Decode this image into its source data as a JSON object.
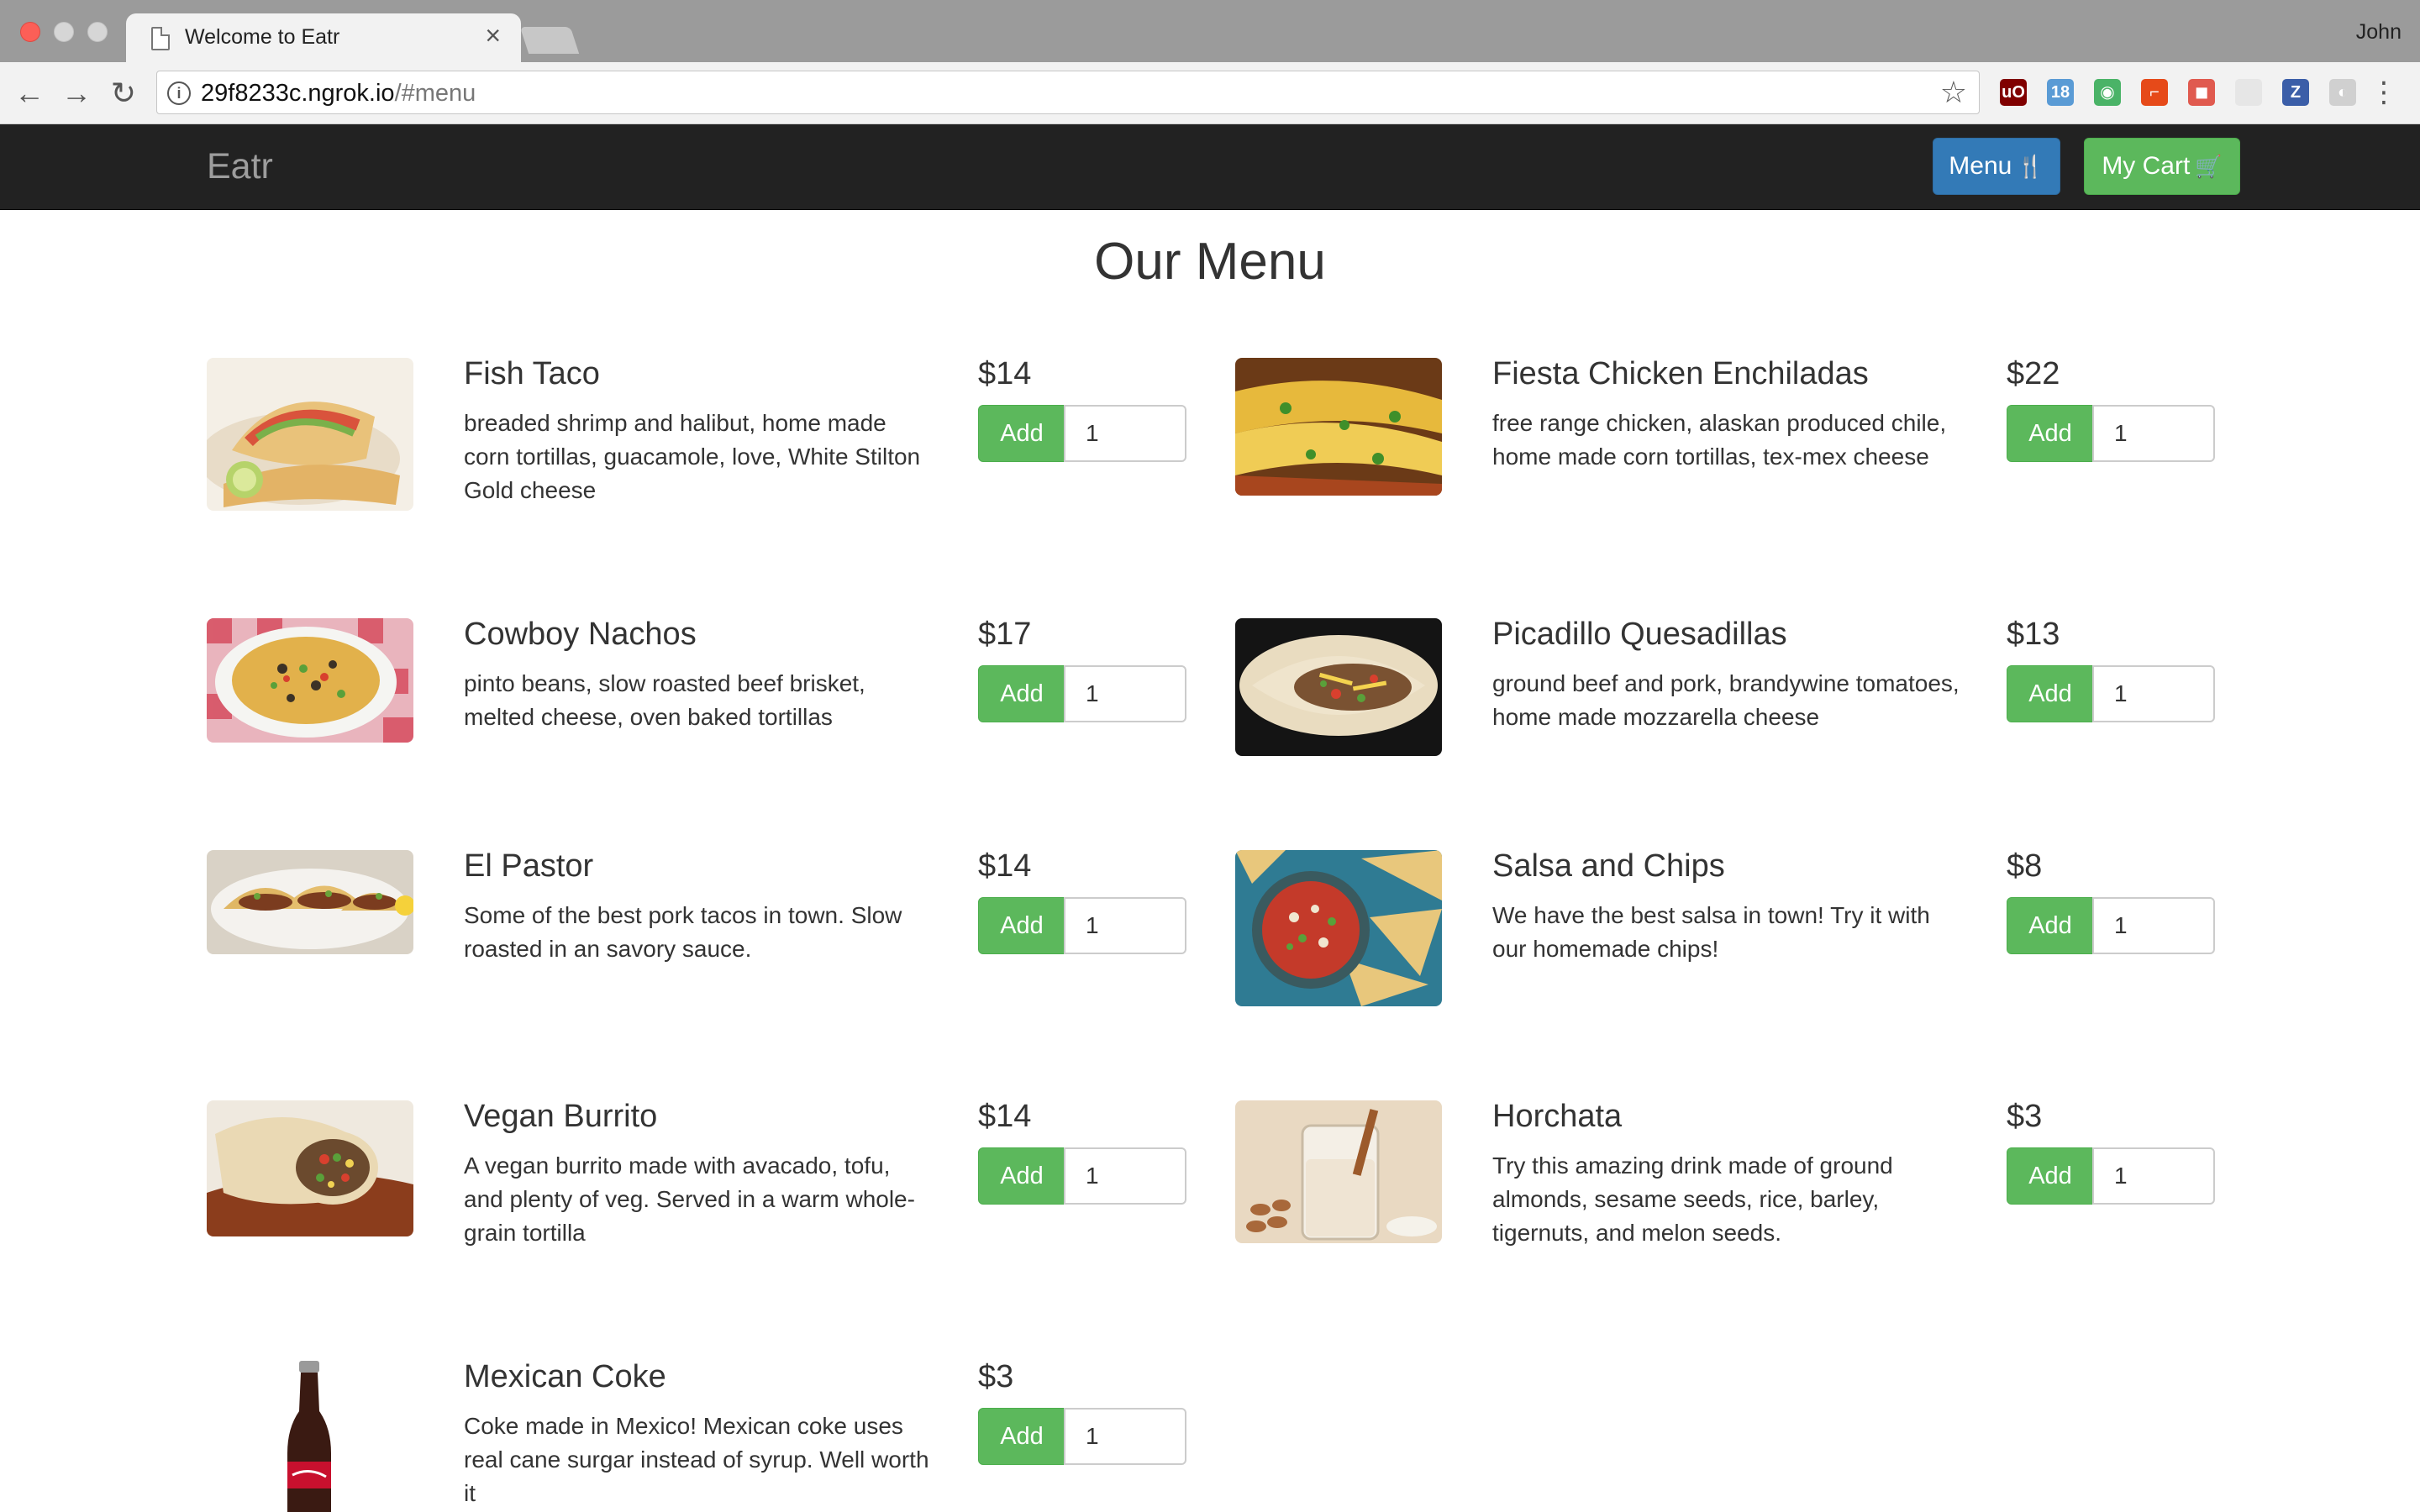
{
  "browser": {
    "tab_title": "Welcome to Eatr",
    "tab_close": "×",
    "profile_name": "John",
    "url_host": "29f8233c.ngrok.io",
    "url_path": "/#menu",
    "back_icon": "←",
    "forward_icon": "→",
    "reload_icon": "↻",
    "info_icon": "i",
    "star_icon": "☆",
    "menu_icon": "⋮",
    "extensions": [
      {
        "name": "ublock-icon",
        "glyph": "uO",
        "color": "#800000"
      },
      {
        "name": "calendar-icon",
        "glyph": "18",
        "color": "#5a9bd5"
      },
      {
        "name": "pushbullet-icon",
        "glyph": "◉",
        "color": "#4ab367"
      },
      {
        "name": "office-icon",
        "glyph": "⌐",
        "color": "#e64a19"
      },
      {
        "name": "screenshot-icon",
        "glyph": "◼",
        "color": "#e05a4f"
      },
      {
        "name": "blank-extension-icon",
        "glyph": "",
        "color": "#e6e6e6"
      },
      {
        "name": "zotero-icon",
        "glyph": "Z",
        "color": "#3b5ea8"
      },
      {
        "name": "feather-icon",
        "glyph": "◐",
        "color": "#d0d0d0"
      }
    ]
  },
  "navbar": {
    "brand": "Eatr",
    "menu_label": "Menu",
    "menu_icon": "🍴",
    "cart_label": "My Cart",
    "cart_icon": "🛒"
  },
  "page": {
    "title": "Our Menu",
    "items": [
      {
        "name": "Fish Taco",
        "description": "breaded shrimp and halibut, home made corn tortillas, guacamole, love, White Stilton Gold cheese",
        "price": "$14",
        "add_label": "Add",
        "qty": "1"
      },
      {
        "name": "Fiesta Chicken Enchiladas",
        "description": "free range chicken, alaskan produced chile, home made corn tortillas, tex-mex cheese",
        "price": "$22",
        "add_label": "Add",
        "qty": "1"
      },
      {
        "name": "Cowboy Nachos",
        "description": "pinto beans, slow roasted beef brisket, melted cheese, oven baked tortillas",
        "price": "$17",
        "add_label": "Add",
        "qty": "1"
      },
      {
        "name": "Picadillo Quesadillas",
        "description": "ground beef and pork, brandywine tomatoes, home made mozzarella cheese",
        "price": "$13",
        "add_label": "Add",
        "qty": "1"
      },
      {
        "name": "El Pastor",
        "description": "Some of the best pork tacos in town. Slow roasted in an savory sauce.",
        "price": "$14",
        "add_label": "Add",
        "qty": "1"
      },
      {
        "name": "Salsa and Chips",
        "description": "We have the best salsa in town! Try it with our homemade chips!",
        "price": "$8",
        "add_label": "Add",
        "qty": "1"
      },
      {
        "name": "Vegan Burrito",
        "description": "A vegan burrito made with avacado, tofu, and plenty of veg. Served in a warm whole-grain tortilla",
        "price": "$14",
        "add_label": "Add",
        "qty": "1"
      },
      {
        "name": "Horchata",
        "description": "Try this amazing drink made of ground almonds, sesame seeds, rice, barley, tigernuts, and melon seeds.",
        "price": "$3",
        "add_label": "Add",
        "qty": "1"
      },
      {
        "name": "Mexican Coke",
        "description": "Coke made in Mexico! Mexican coke uses real cane surgar instead of syrup. Well worth it",
        "price": "$3",
        "add_label": "Add",
        "qty": "1"
      }
    ]
  },
  "colors": {
    "navbar_bg": "#222222",
    "primary": "#337ab7",
    "success": "#5cb85c"
  }
}
